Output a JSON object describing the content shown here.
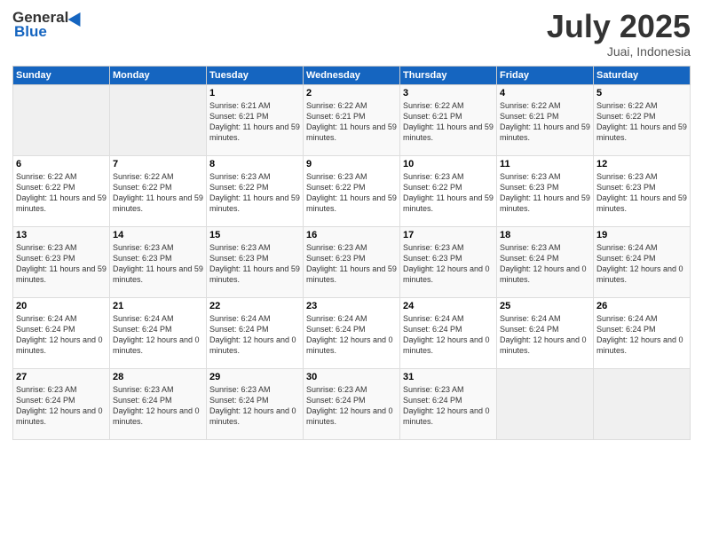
{
  "logo": {
    "general": "General",
    "blue": "Blue"
  },
  "header": {
    "month": "July 2025",
    "location": "Juai, Indonesia"
  },
  "days": [
    "Sunday",
    "Monday",
    "Tuesday",
    "Wednesday",
    "Thursday",
    "Friday",
    "Saturday"
  ],
  "weeks": [
    [
      {
        "date": "",
        "sunrise": "",
        "sunset": "",
        "daylight": ""
      },
      {
        "date": "",
        "sunrise": "",
        "sunset": "",
        "daylight": ""
      },
      {
        "date": "1",
        "sunrise": "Sunrise: 6:21 AM",
        "sunset": "Sunset: 6:21 PM",
        "daylight": "Daylight: 11 hours and 59 minutes."
      },
      {
        "date": "2",
        "sunrise": "Sunrise: 6:22 AM",
        "sunset": "Sunset: 6:21 PM",
        "daylight": "Daylight: 11 hours and 59 minutes."
      },
      {
        "date": "3",
        "sunrise": "Sunrise: 6:22 AM",
        "sunset": "Sunset: 6:21 PM",
        "daylight": "Daylight: 11 hours and 59 minutes."
      },
      {
        "date": "4",
        "sunrise": "Sunrise: 6:22 AM",
        "sunset": "Sunset: 6:21 PM",
        "daylight": "Daylight: 11 hours and 59 minutes."
      },
      {
        "date": "5",
        "sunrise": "Sunrise: 6:22 AM",
        "sunset": "Sunset: 6:22 PM",
        "daylight": "Daylight: 11 hours and 59 minutes."
      }
    ],
    [
      {
        "date": "6",
        "sunrise": "Sunrise: 6:22 AM",
        "sunset": "Sunset: 6:22 PM",
        "daylight": "Daylight: 11 hours and 59 minutes."
      },
      {
        "date": "7",
        "sunrise": "Sunrise: 6:22 AM",
        "sunset": "Sunset: 6:22 PM",
        "daylight": "Daylight: 11 hours and 59 minutes."
      },
      {
        "date": "8",
        "sunrise": "Sunrise: 6:23 AM",
        "sunset": "Sunset: 6:22 PM",
        "daylight": "Daylight: 11 hours and 59 minutes."
      },
      {
        "date": "9",
        "sunrise": "Sunrise: 6:23 AM",
        "sunset": "Sunset: 6:22 PM",
        "daylight": "Daylight: 11 hours and 59 minutes."
      },
      {
        "date": "10",
        "sunrise": "Sunrise: 6:23 AM",
        "sunset": "Sunset: 6:22 PM",
        "daylight": "Daylight: 11 hours and 59 minutes."
      },
      {
        "date": "11",
        "sunrise": "Sunrise: 6:23 AM",
        "sunset": "Sunset: 6:23 PM",
        "daylight": "Daylight: 11 hours and 59 minutes."
      },
      {
        "date": "12",
        "sunrise": "Sunrise: 6:23 AM",
        "sunset": "Sunset: 6:23 PM",
        "daylight": "Daylight: 11 hours and 59 minutes."
      }
    ],
    [
      {
        "date": "13",
        "sunrise": "Sunrise: 6:23 AM",
        "sunset": "Sunset: 6:23 PM",
        "daylight": "Daylight: 11 hours and 59 minutes."
      },
      {
        "date": "14",
        "sunrise": "Sunrise: 6:23 AM",
        "sunset": "Sunset: 6:23 PM",
        "daylight": "Daylight: 11 hours and 59 minutes."
      },
      {
        "date": "15",
        "sunrise": "Sunrise: 6:23 AM",
        "sunset": "Sunset: 6:23 PM",
        "daylight": "Daylight: 11 hours and 59 minutes."
      },
      {
        "date": "16",
        "sunrise": "Sunrise: 6:23 AM",
        "sunset": "Sunset: 6:23 PM",
        "daylight": "Daylight: 11 hours and 59 minutes."
      },
      {
        "date": "17",
        "sunrise": "Sunrise: 6:23 AM",
        "sunset": "Sunset: 6:23 PM",
        "daylight": "Daylight: 12 hours and 0 minutes."
      },
      {
        "date": "18",
        "sunrise": "Sunrise: 6:23 AM",
        "sunset": "Sunset: 6:24 PM",
        "daylight": "Daylight: 12 hours and 0 minutes."
      },
      {
        "date": "19",
        "sunrise": "Sunrise: 6:24 AM",
        "sunset": "Sunset: 6:24 PM",
        "daylight": "Daylight: 12 hours and 0 minutes."
      }
    ],
    [
      {
        "date": "20",
        "sunrise": "Sunrise: 6:24 AM",
        "sunset": "Sunset: 6:24 PM",
        "daylight": "Daylight: 12 hours and 0 minutes."
      },
      {
        "date": "21",
        "sunrise": "Sunrise: 6:24 AM",
        "sunset": "Sunset: 6:24 PM",
        "daylight": "Daylight: 12 hours and 0 minutes."
      },
      {
        "date": "22",
        "sunrise": "Sunrise: 6:24 AM",
        "sunset": "Sunset: 6:24 PM",
        "daylight": "Daylight: 12 hours and 0 minutes."
      },
      {
        "date": "23",
        "sunrise": "Sunrise: 6:24 AM",
        "sunset": "Sunset: 6:24 PM",
        "daylight": "Daylight: 12 hours and 0 minutes."
      },
      {
        "date": "24",
        "sunrise": "Sunrise: 6:24 AM",
        "sunset": "Sunset: 6:24 PM",
        "daylight": "Daylight: 12 hours and 0 minutes."
      },
      {
        "date": "25",
        "sunrise": "Sunrise: 6:24 AM",
        "sunset": "Sunset: 6:24 PM",
        "daylight": "Daylight: 12 hours and 0 minutes."
      },
      {
        "date": "26",
        "sunrise": "Sunrise: 6:24 AM",
        "sunset": "Sunset: 6:24 PM",
        "daylight": "Daylight: 12 hours and 0 minutes."
      }
    ],
    [
      {
        "date": "27",
        "sunrise": "Sunrise: 6:23 AM",
        "sunset": "Sunset: 6:24 PM",
        "daylight": "Daylight: 12 hours and 0 minutes."
      },
      {
        "date": "28",
        "sunrise": "Sunrise: 6:23 AM",
        "sunset": "Sunset: 6:24 PM",
        "daylight": "Daylight: 12 hours and 0 minutes."
      },
      {
        "date": "29",
        "sunrise": "Sunrise: 6:23 AM",
        "sunset": "Sunset: 6:24 PM",
        "daylight": "Daylight: 12 hours and 0 minutes."
      },
      {
        "date": "30",
        "sunrise": "Sunrise: 6:23 AM",
        "sunset": "Sunset: 6:24 PM",
        "daylight": "Daylight: 12 hours and 0 minutes."
      },
      {
        "date": "31",
        "sunrise": "Sunrise: 6:23 AM",
        "sunset": "Sunset: 6:24 PM",
        "daylight": "Daylight: 12 hours and 0 minutes."
      },
      {
        "date": "",
        "sunrise": "",
        "sunset": "",
        "daylight": ""
      },
      {
        "date": "",
        "sunrise": "",
        "sunset": "",
        "daylight": ""
      }
    ]
  ]
}
